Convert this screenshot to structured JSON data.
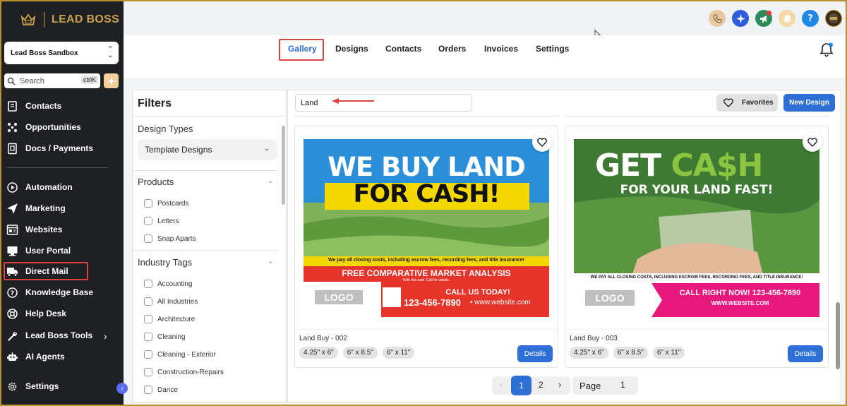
{
  "brand": {
    "name": "LEAD BOSS"
  },
  "account": {
    "name": "Lead Boss Sandbox"
  },
  "search": {
    "placeholder": "Search",
    "shortcut": "ctrlK"
  },
  "sidebar": {
    "items": [
      {
        "label": "Contacts",
        "icon": "contacts-icon"
      },
      {
        "label": "Opportunities",
        "icon": "opportunities-icon"
      },
      {
        "label": "Docs / Payments",
        "icon": "docs-icon"
      },
      {
        "label": "Automation",
        "icon": "automation-icon"
      },
      {
        "label": "Marketing",
        "icon": "marketing-icon"
      },
      {
        "label": "Websites",
        "icon": "websites-icon"
      },
      {
        "label": "User Portal",
        "icon": "monitor-icon"
      },
      {
        "label": "Direct Mail",
        "icon": "mail-truck-icon"
      },
      {
        "label": "Knowledge Base",
        "icon": "question-icon"
      },
      {
        "label": "Help Desk",
        "icon": "lifebuoy-icon"
      },
      {
        "label": "Lead Boss Tools",
        "icon": "wrench-icon"
      },
      {
        "label": "AI Agents",
        "icon": "robot-icon"
      }
    ],
    "settings_label": "Settings"
  },
  "tabs": [
    {
      "label": "Gallery",
      "active": true
    },
    {
      "label": "Designs"
    },
    {
      "label": "Contacts"
    },
    {
      "label": "Orders"
    },
    {
      "label": "Invoices"
    },
    {
      "label": "Settings"
    }
  ],
  "filters": {
    "title": "Filters",
    "design_types": {
      "label": "Design Types",
      "selected": "Template Designs"
    },
    "products": {
      "label": "Products",
      "options": [
        "Postcards",
        "Letters",
        "Snap Aparts"
      ]
    },
    "industry_tags": {
      "label": "Industry Tags",
      "options": [
        "Accounting",
        "All Industries",
        "Architecture",
        "Cleaning",
        "Cleaning - Exterior",
        "Construction-Repairs",
        "Dance"
      ]
    }
  },
  "gallery": {
    "search_value": "Land",
    "favorites_label": "Favorites",
    "new_design_label": "New Design",
    "cards": [
      {
        "name": "Land Buy - 002",
        "sizes": [
          "4.25\" x 6\"",
          "6\" x 8.5\"",
          "6\" x 11\""
        ],
        "details_label": "Details",
        "art": {
          "headline1": "WE BUY LAND",
          "headline2": "FOR CASH!",
          "disclaimer": "We pay all closing costs, including escrow fees, recording fees, and title insurance!",
          "offer": "FREE COMPARATIVE MARKET ANALYSIS",
          "fine": "With this card. Call for details.",
          "logo": "LOGO",
          "cta": "CALL US TODAY!",
          "phone": "123-456-7890",
          "web": "• www.website.com"
        }
      },
      {
        "name": "Land Buy - 003",
        "sizes": [
          "4.25\" x 6\"",
          "6\" x 8.5\"",
          "6\" x 11\""
        ],
        "details_label": "Details",
        "art": {
          "headline1": "GET ",
          "headline1b": "CA$H",
          "headline2": "FOR YOUR LAND FAST!",
          "disclaimer": "WE PAY ALL CLOSING COSTS, INCLUDING ESCROW FEES, RECORDING FEES, AND TITLE INSURANCE!",
          "logo": "LOGO",
          "cta": "CALL RIGHT NOW! 123-456-7890",
          "web": "WWW.WEBSITE.COM"
        }
      }
    ]
  },
  "pagination": {
    "prev": "‹",
    "pages": [
      "1",
      "2"
    ],
    "current": "1",
    "next": "›",
    "page_label": "Page",
    "page_value": "1"
  },
  "colors": {
    "accent": "#2e6fd6",
    "sidebar_bg": "#1f2024",
    "brand_gold": "#c9a24c",
    "highlight_red": "#d8423f"
  }
}
